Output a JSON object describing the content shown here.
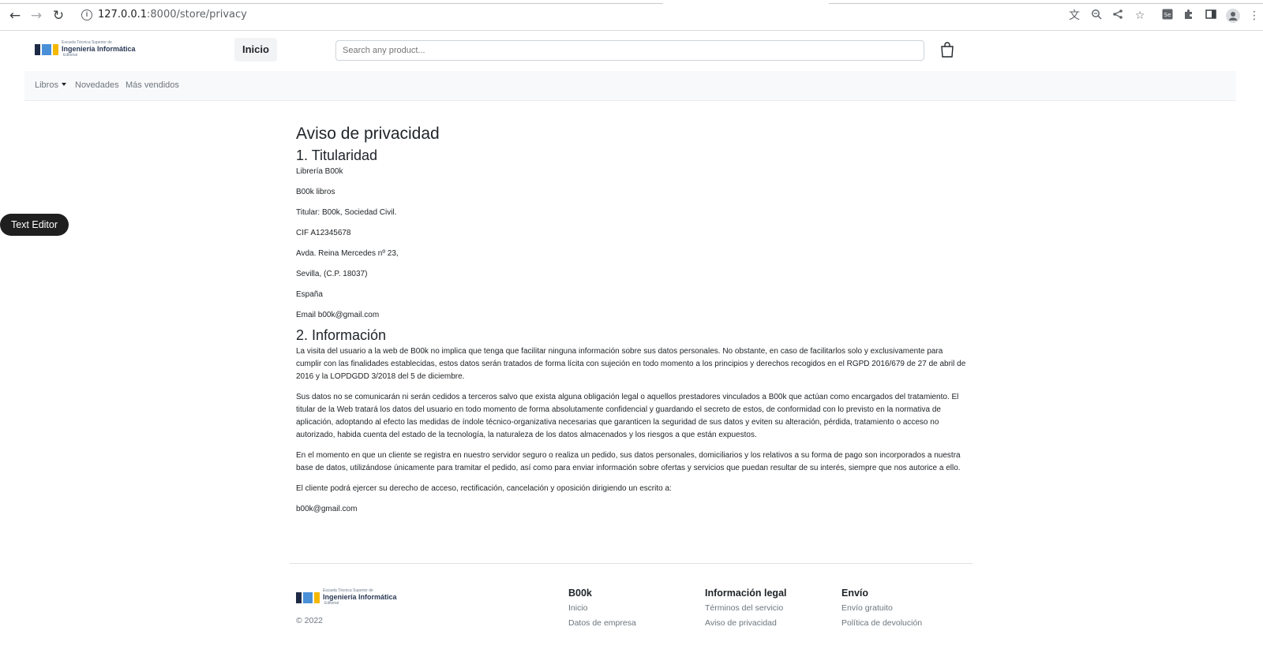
{
  "browser": {
    "url_host": "127.0.0.1",
    "url_path": ":8000/store/privacy"
  },
  "logo": {
    "line1": "Escuela Técnica Superior de",
    "line2": "Ingeniería Informática",
    "line3": "Editorial",
    "colors": [
      "#1e2a45",
      "#4a90d9",
      "#f5b800"
    ]
  },
  "header": {
    "home_label": "Inicio",
    "search_placeholder": "Search any product..."
  },
  "subnav": {
    "items": [
      "Libros",
      "Novedades",
      "Más vendidos"
    ]
  },
  "text_editor_label": "Text Editor",
  "content": {
    "title": "Aviso de privacidad",
    "section1_title": "1. Titularidad",
    "section1_lines": [
      "Librería B00k",
      "B00k libros",
      "Titular: B00k, Sociedad Civil.",
      "CIF A12345678",
      "Avda. Reina Mercedes nº 23,",
      "Sevilla, (C.P. 18037)",
      "España",
      "Email b00k@gmail.com"
    ],
    "section2_title": "2. Información",
    "section2_paragraphs": [
      "La visita del usuario a la web de B00k no implica que tenga que facilitar ninguna información sobre sus datos personales. No obstante, en caso de facilitarlos solo y exclusivamente para cumplir con las finalidades establecidas, estos datos serán tratados de forma lícita con sujeción en todo momento a los principios y derechos recogidos en el RGPD 2016/679 de 27 de abril de 2016 y la LOPDGDD 3/2018 del 5 de diciembre.",
      "Sus datos no se comunicarán ni serán cedidos a terceros salvo que exista alguna obligación legal o aquellos prestadores vinculados a B00k que actúan como encargados del tratamiento. El titular de la Web tratará los datos del usuario en todo momento de forma absolutamente confidencial y guardando el secreto de estos, de conformidad con lo previsto en la normativa de aplicación, adoptando al efecto las medidas de índole técnico-organizativa necesarias que garanticen la seguridad de sus datos y eviten su alteración, pérdida, tratamiento o acceso no autorizado, habida cuenta del estado de la tecnología, la naturaleza de los datos almacenados y los riesgos a que están expuestos.",
      "En el momento en que un cliente se registra en nuestro servidor seguro o realiza un pedido, sus datos personales, domiciliarios y los relativos a su forma de pago son incorporados a nuestra base de datos, utilizándose únicamente para tramitar el pedido, así como para enviar información sobre ofertas y servicios que puedan resultar de su interés, siempre que nos autorice a ello.",
      "El cliente podrá ejercer su derecho de acceso, rectificación, cancelación y oposición dirigiendo un escrito a:",
      "b00k@gmail.com"
    ]
  },
  "footer": {
    "copyright": "© 2022",
    "col1": {
      "title": "B00k",
      "links": [
        "Inicio",
        "Datos de empresa"
      ]
    },
    "col2": {
      "title": "Información legal",
      "links": [
        "Términos del servicio",
        "Aviso de privacidad"
      ]
    },
    "col3": {
      "title": "Envío",
      "links": [
        "Envío gratuito",
        "Política de devolución"
      ]
    }
  }
}
